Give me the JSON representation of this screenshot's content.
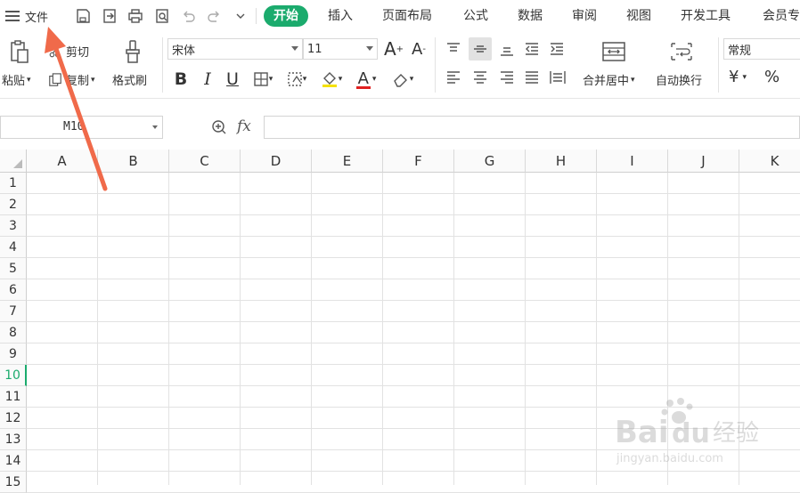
{
  "topbar": {
    "file_label": "文件",
    "tabs": [
      {
        "label": "开始",
        "active": true
      },
      {
        "label": "插入"
      },
      {
        "label": "页面布局"
      },
      {
        "label": "公式"
      },
      {
        "label": "数据"
      },
      {
        "label": "审阅"
      },
      {
        "label": "视图"
      },
      {
        "label": "开发工具"
      },
      {
        "label": "会员专"
      }
    ]
  },
  "ribbon": {
    "paste": "粘贴",
    "cut": "剪切",
    "copy": "复制",
    "format_painter": "格式刷",
    "font_name": "宋体",
    "font_size": "11",
    "bold": "B",
    "italic": "I",
    "underline": "U",
    "font_color_glyph": "A",
    "merge_center": "合并居中",
    "wrap_text": "自动换行",
    "number_format": "常规",
    "currency": "¥",
    "percent": "%"
  },
  "formula_bar": {
    "name_box": "M10",
    "fx": "fx"
  },
  "grid": {
    "columns": [
      "A",
      "B",
      "C",
      "D",
      "E",
      "F",
      "G",
      "H",
      "I",
      "J",
      "K"
    ],
    "rows": [
      "1",
      "2",
      "3",
      "4",
      "5",
      "6",
      "7",
      "8",
      "9",
      "10",
      "11",
      "12",
      "13",
      "14",
      "15"
    ],
    "selected_row": "10"
  },
  "watermark": {
    "brand": "Bai",
    "brand2": "du",
    "cn": "经验",
    "url": "jingyan.baidu.com"
  },
  "colors": {
    "accent": "#1bab6d",
    "arrow": "#f06a4a"
  }
}
